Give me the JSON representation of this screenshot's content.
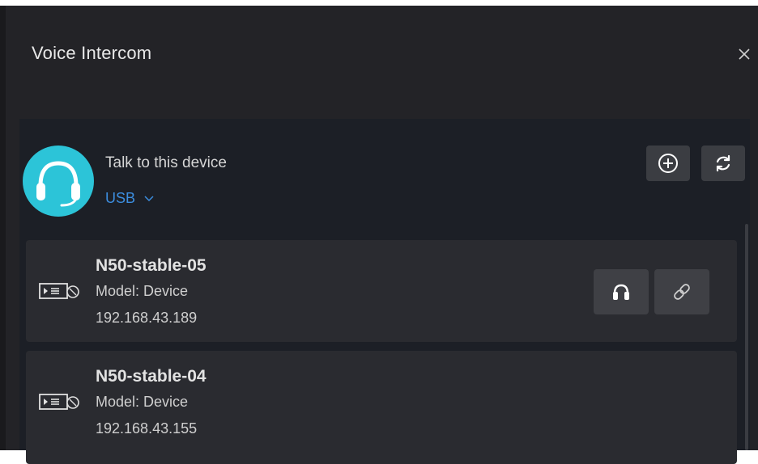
{
  "dialog": {
    "title": "Voice Intercom",
    "close_icon": "close-icon"
  },
  "talk": {
    "label": "Talk to this device",
    "source": "USB",
    "avatar_icon": "headset-icon",
    "accent_color": "#2cc4d8",
    "link_color": "#3c8ee0"
  },
  "toolbar": {
    "add_icon": "add-circle-icon",
    "refresh_icon": "refresh-icon"
  },
  "devices": [
    {
      "name": "N50-stable-05",
      "model": "Model: Device",
      "ip": "192.168.43.189",
      "icon": "device-icon",
      "actions": [
        "headphones-icon",
        "link-icon"
      ]
    },
    {
      "name": "N50-stable-04",
      "model": "Model: Device",
      "ip": "192.168.43.155",
      "icon": "device-icon"
    }
  ]
}
